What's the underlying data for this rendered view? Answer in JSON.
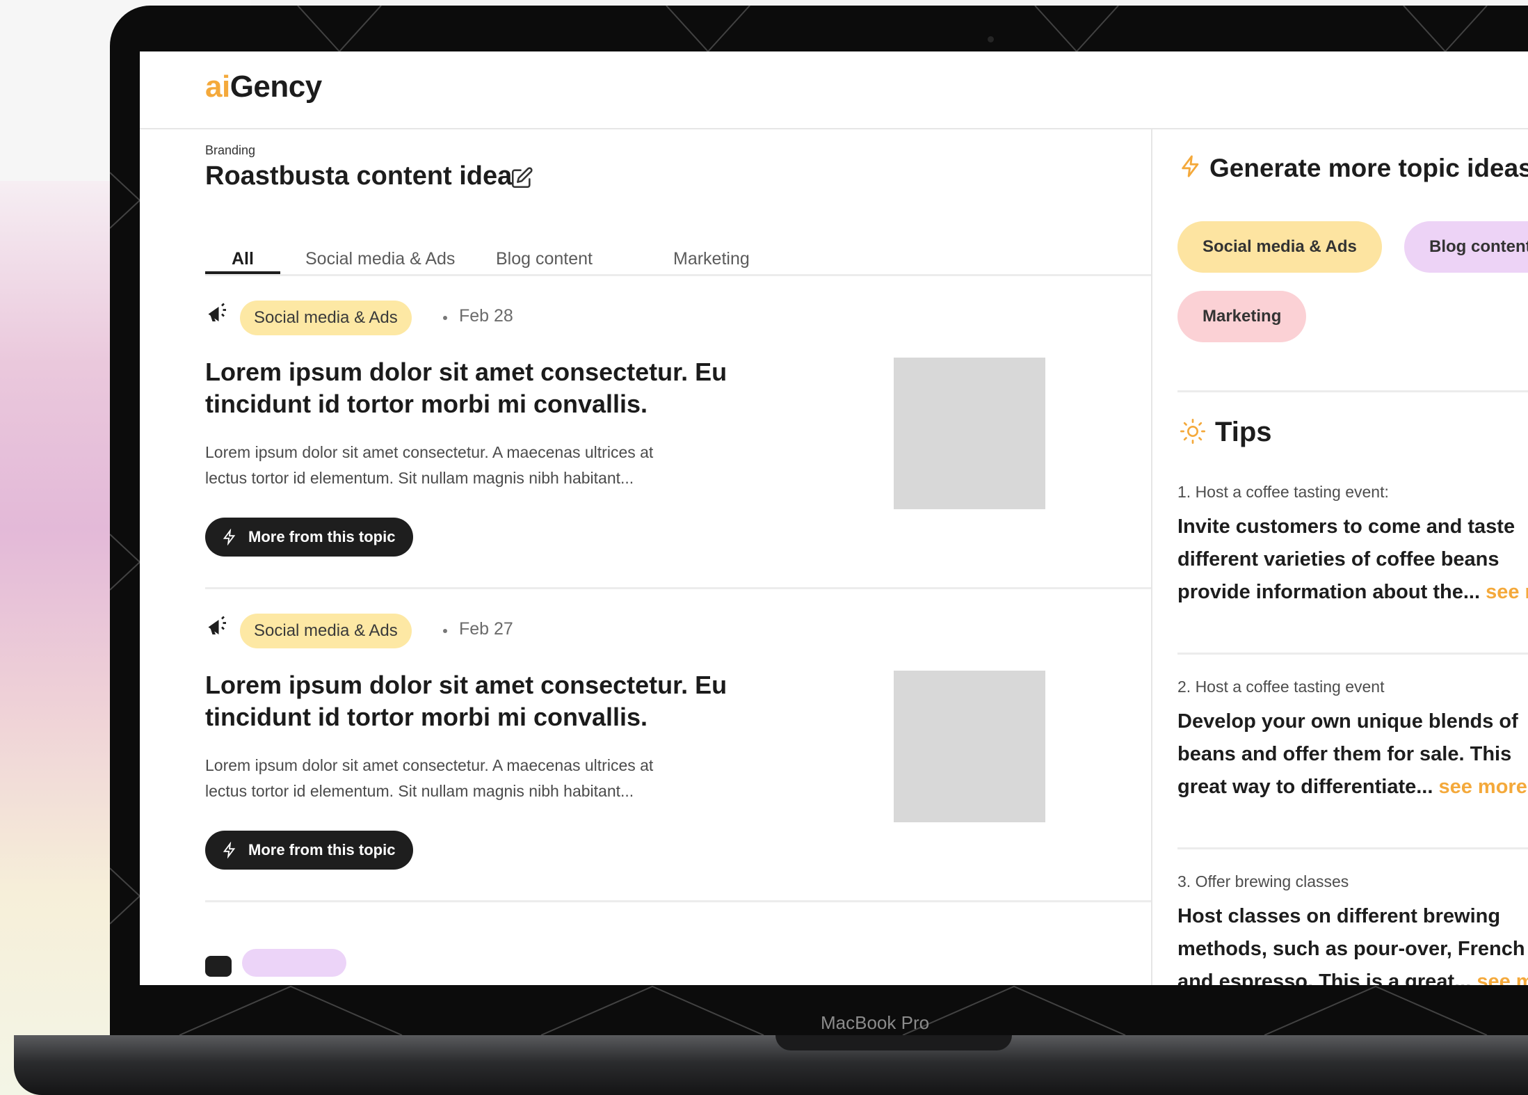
{
  "device": {
    "label": "MacBook Pro"
  },
  "app": {
    "logo_prefix": "ai",
    "logo_suffix": "Gency"
  },
  "page": {
    "breadcrumb": "Branding",
    "title": "Roastbusta content idea"
  },
  "tabs": [
    "All",
    "Social media & Ads",
    "Blog content",
    "Marketing"
  ],
  "active_tab": "All",
  "cards": [
    {
      "category": "Social media & Ads",
      "date": "Feb 28",
      "title": "Lorem ipsum dolor sit amet consectetur. Eu tincidunt id tortor morbi mi convallis.",
      "desc_line1": "Lorem ipsum dolor sit amet consectetur. A maecenas ultrices at",
      "desc_line2": "lectus tortor id elementum. Sit nullam magnis nibh habitant...",
      "button": "More from this topic"
    },
    {
      "category": "Social media & Ads",
      "date": "Feb 27",
      "title": "Lorem ipsum dolor sit amet consectetur. Eu tincidunt id tortor morbi mi convallis.",
      "desc_line1": "Lorem ipsum dolor sit amet consectetur. A maecenas ultrices at",
      "desc_line2": "lectus tortor id elementum. Sit nullam magnis nibh habitant...",
      "button": "More from this topic"
    }
  ],
  "sidebar": {
    "generate_title": "Generate more topic ideas",
    "chips": [
      "Social media & Ads",
      "Blog content",
      "Marketing"
    ],
    "tips_title": "Tips",
    "tips": [
      {
        "label": "1. Host a coffee tasting event:",
        "line1": "Invite customers to come and taste",
        "line2": "different varieties of coffee beans",
        "line3": "provide information about the...",
        "see_more": "see more"
      },
      {
        "label": "2. Host a coffee tasting event",
        "line1": "Develop your own unique blends of",
        "line2": "beans and offer them for sale. This",
        "line3": "great way to differentiate...",
        "see_more": "see more"
      },
      {
        "label": "3. Offer brewing classes",
        "line1": "Host classes on different brewing",
        "line2": "methods, such as pour-over, French",
        "line3": "and espresso. This is a great...",
        "see_more": "see more"
      }
    ]
  },
  "colors": {
    "accent": "#f4a93b",
    "social_badge": "#fde8a4",
    "blog_badge": "#edd3f6",
    "marketing_badge": "#fbd1d5",
    "dark_button": "#1e1e1e"
  }
}
